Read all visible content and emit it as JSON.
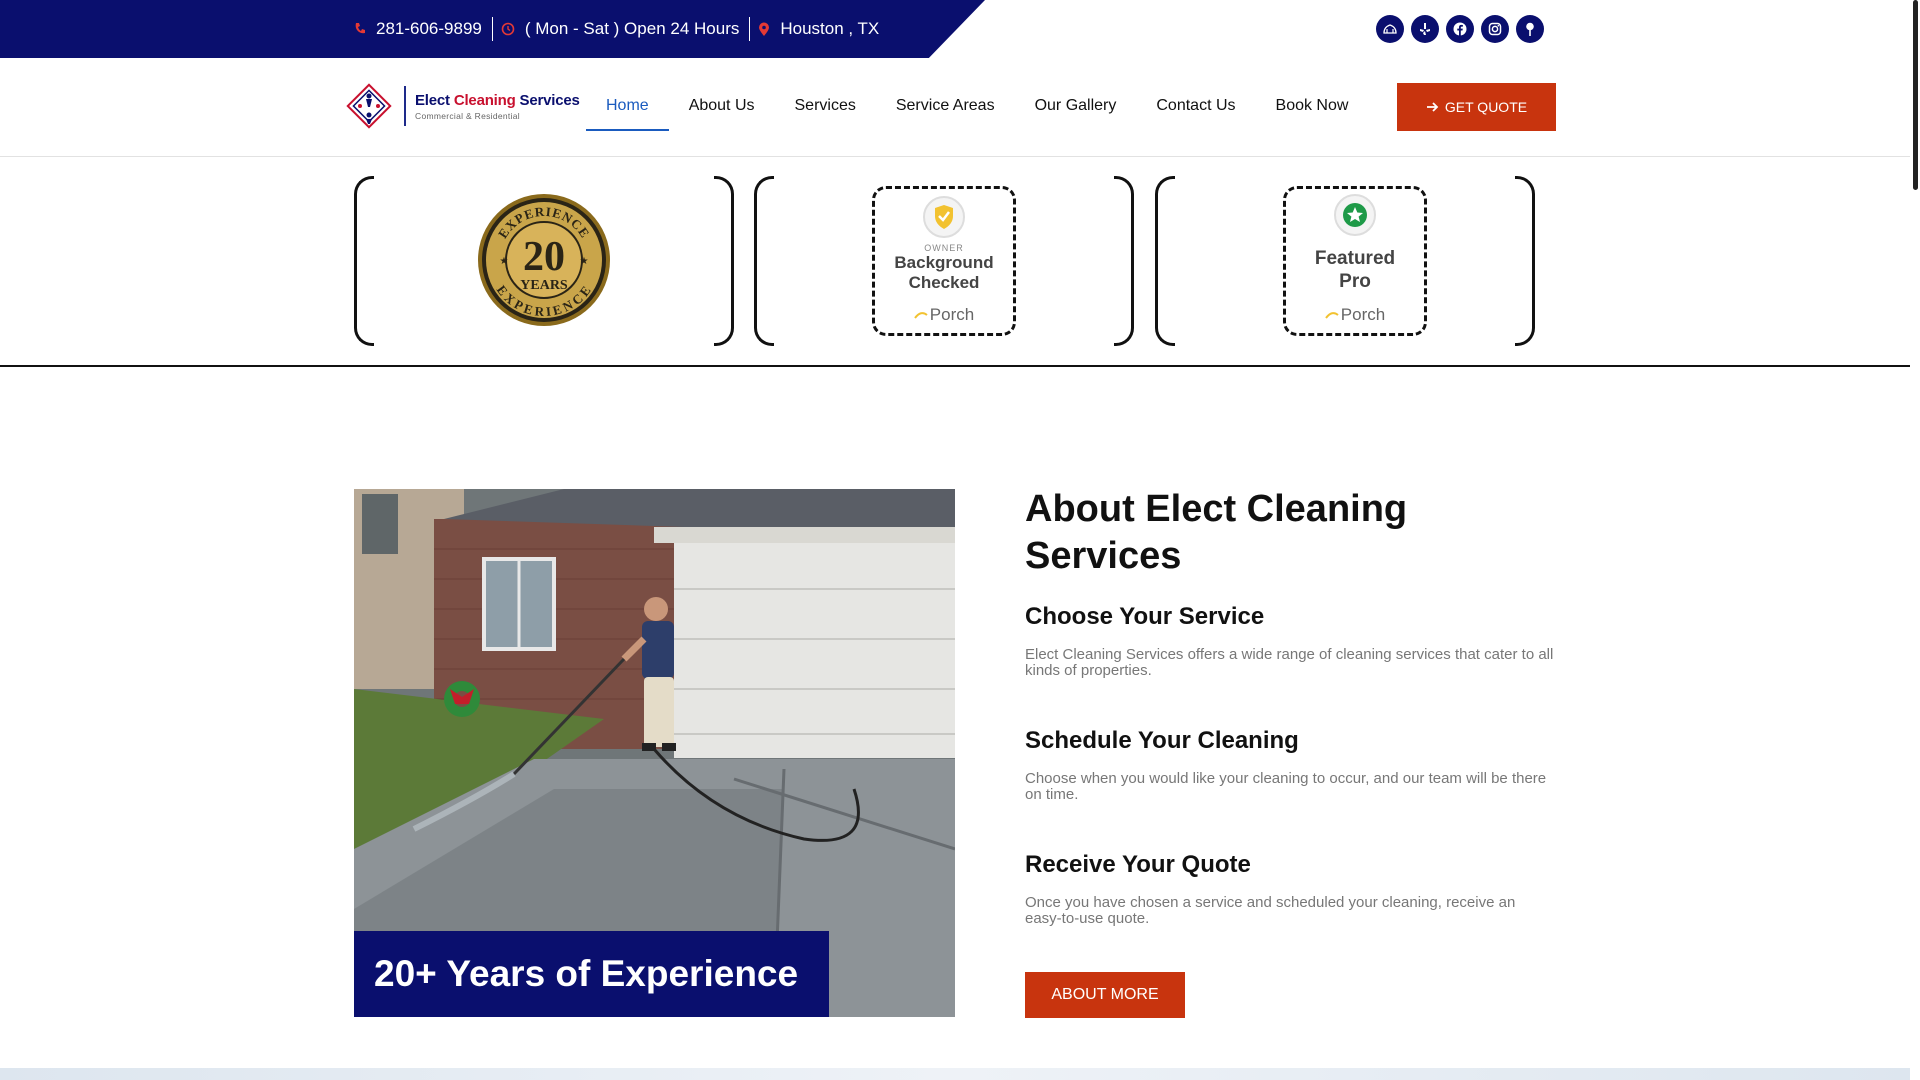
{
  "topbar": {
    "phone": "281-606-9899",
    "hours": "( Mon - Sat ) Open 24 Hours",
    "location": "Houston , TX",
    "socials": [
      "porch-icon",
      "yelp-icon",
      "facebook-icon",
      "instagram-icon",
      "map-pin-icon"
    ]
  },
  "logo": {
    "name_part1": "Elect ",
    "name_accent": "Cleaning",
    "name_part2": " Services",
    "tagline": "Commercial & Residential"
  },
  "nav": {
    "items": [
      "Home",
      "About Us",
      "Services",
      "Service Areas",
      "Our Gallery",
      "Contact Us",
      "Book Now"
    ],
    "active": "Home",
    "quote_button": "GET QUOTE"
  },
  "badges": {
    "experience": {
      "number": "20",
      "word": "YEARS",
      "ring_top": "EXPERIENCE",
      "ring_bottom": "EXPERIENCE"
    },
    "owner_checked": {
      "small": "OWNER",
      "title_line1": "Background",
      "title_line2": "Checked",
      "brand": "Porch"
    },
    "featured": {
      "title_line1": "Featured",
      "title_line2": "Pro",
      "brand": "Porch"
    }
  },
  "about": {
    "photo_caption": "20+ Years of Experience",
    "title": "About Elect Cleaning Services",
    "steps": [
      {
        "title": "Choose Your Service",
        "text": "Elect Cleaning Services offers a wide range of cleaning services that cater to all kinds of properties."
      },
      {
        "title": "Schedule Your Cleaning",
        "text": "Choose when you would like your cleaning to occur, and our team will be there on time."
      },
      {
        "title": "Receive Your Quote",
        "text": "Once you have chosen a service and scheduled your cleaning, receive an easy-to-use quote."
      }
    ],
    "button": "ABOUT MORE"
  },
  "colors": {
    "navy": "#0a0f6e",
    "accent_orange": "#c8340e",
    "active_link": "#1a5bbf",
    "icon_red": "#e53935"
  }
}
